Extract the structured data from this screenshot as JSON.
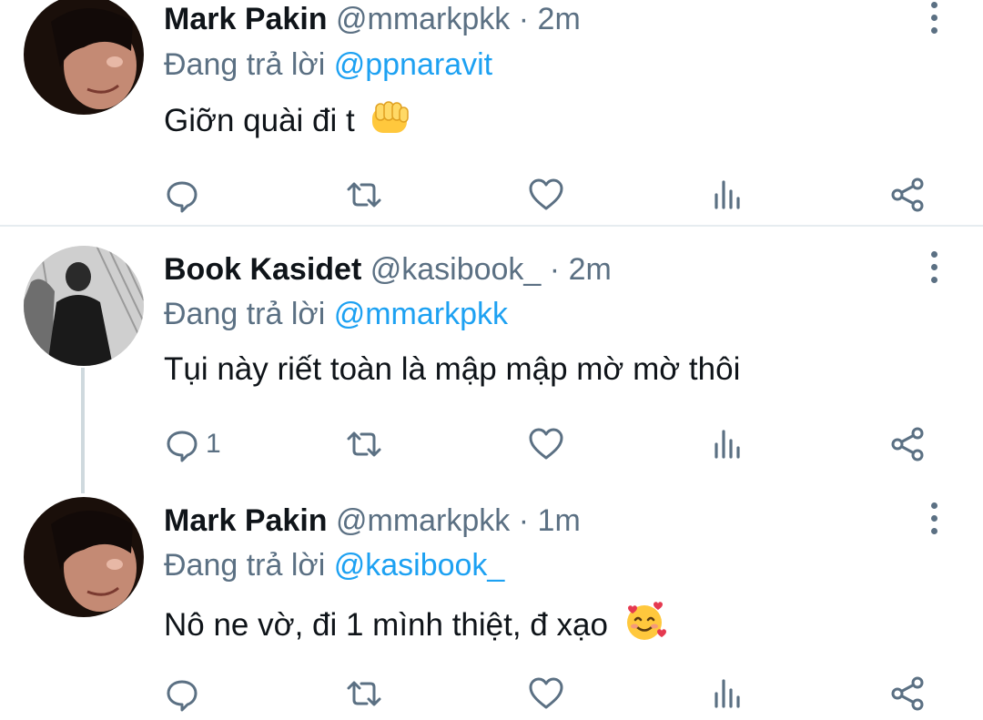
{
  "reply_prefix": "Đang trả lời",
  "tweets": [
    {
      "name": "Mark Pakin",
      "handle": "@mmarkpkk",
      "dot": "·",
      "time": "2m",
      "replying_to": "@ppnaravit",
      "text": "Giỡn quài đi t",
      "emoji": "oncoming-fist",
      "reply_count": ""
    },
    {
      "name": "Book Kasidet",
      "handle": "@kasibook_",
      "dot": "·",
      "time": "2m",
      "replying_to": "@mmarkpkk",
      "text": "Tụi này riết toàn là mập mập mờ mờ thôi",
      "emoji": "",
      "reply_count": "1"
    },
    {
      "name": "Mark Pakin",
      "handle": "@mmarkpkk",
      "dot": "·",
      "time": "1m",
      "replying_to": "@kasibook_",
      "text": "Nô ne vờ, đi 1 mình thiệt, đ xạo",
      "emoji": "smiling-face-with-hearts",
      "reply_count": ""
    }
  ],
  "icons": [
    "reply-icon",
    "retweet-icon",
    "like-icon",
    "analytics-icon",
    "share-icon",
    "more-options-icon"
  ],
  "colors": {
    "accent": "#1da1f2",
    "secondary_text": "#5b7083",
    "primary_text": "#0f1419"
  }
}
